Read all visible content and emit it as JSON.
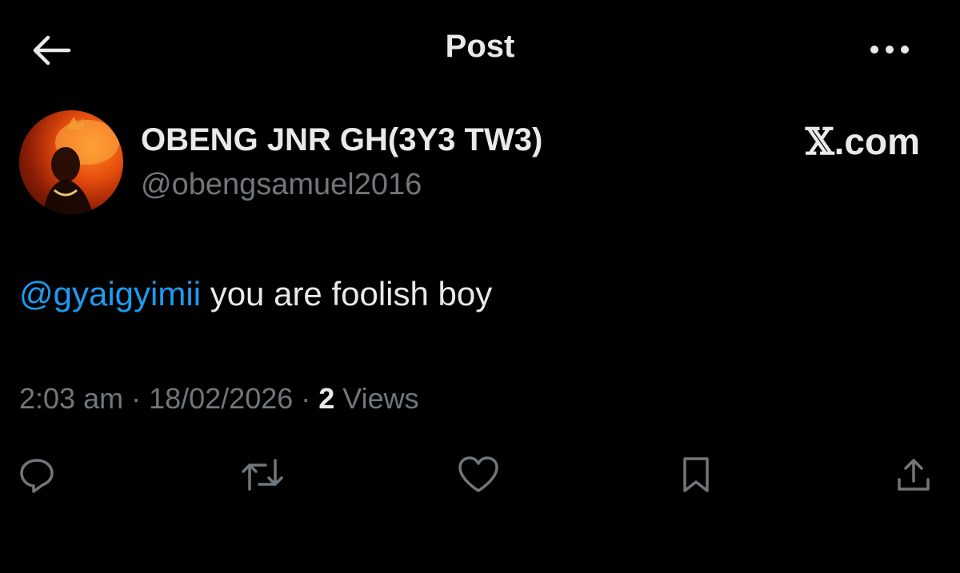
{
  "header": {
    "title": "Post",
    "back_icon": "arrow-left-icon",
    "more_icon": "more-horizontal-icon"
  },
  "author": {
    "name": "OBENG JNR GH(3Y3 TW3)",
    "handle": "@obengsamuel2016",
    "avatar_icon": "avatar-image"
  },
  "brand": {
    "glyph": "𝕏",
    "text": ".com"
  },
  "post": {
    "mention": "@gyaigyimii",
    "text": " you are foolish boy"
  },
  "meta": {
    "time": "2:03 am",
    "separator": " · ",
    "date": "18/02/2026",
    "views_count": "2",
    "views_label": " Views"
  },
  "actions": [
    {
      "icon": "reply-icon"
    },
    {
      "icon": "repost-icon"
    },
    {
      "icon": "like-icon"
    },
    {
      "icon": "bookmark-icon"
    },
    {
      "icon": "share-icon"
    }
  ],
  "colors": {
    "background": "#000000",
    "text_primary": "#e7e9ea",
    "text_secondary": "#71767b",
    "accent": "#1d9bf0"
  }
}
